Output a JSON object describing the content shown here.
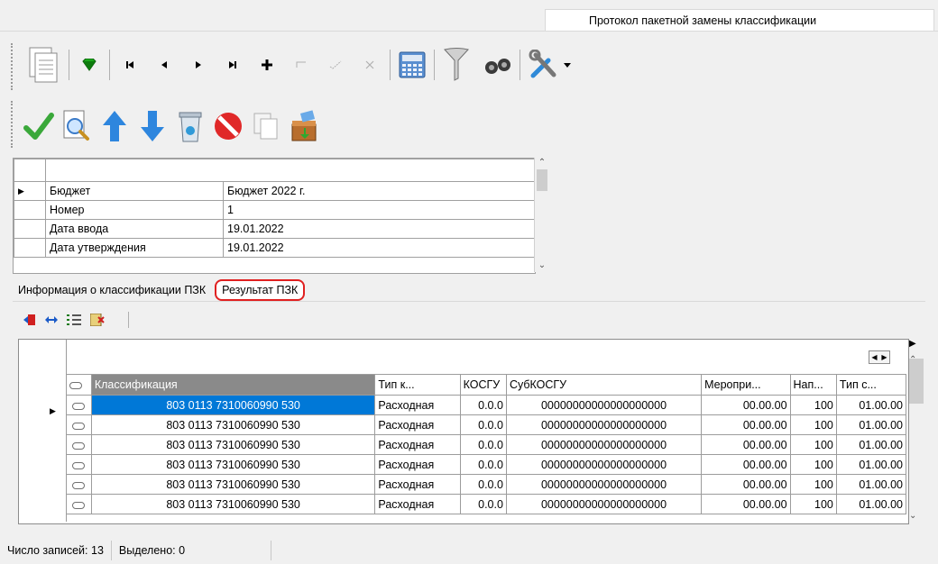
{
  "window": {
    "tab_title": "Протокол пакетной замены классификации"
  },
  "toolbar1": {
    "icons": [
      "document-icon",
      "gem-icon",
      "first-record-icon",
      "prev-record-icon",
      "next-record-icon",
      "last-record-icon",
      "add-icon",
      "edit-icon",
      "post-icon",
      "cancel-icon",
      "calculator-icon",
      "filter-icon",
      "binoculars-icon",
      "tools-icon",
      "dropdown-arrow-icon"
    ]
  },
  "toolbar2": {
    "icons": [
      "checkmark-icon",
      "preview-icon",
      "arrow-up-icon",
      "arrow-down-icon",
      "trash-icon",
      "stop-icon",
      "copy-icon",
      "export-icon"
    ]
  },
  "header_grid": {
    "rows": [
      {
        "label": "Бюджет",
        "value": "Бюджет 2022 г."
      },
      {
        "label": "Номер",
        "value": "1"
      },
      {
        "label": "Дата ввода",
        "value": "19.01.2022"
      },
      {
        "label": "Дата утверждения",
        "value": "19.01.2022"
      }
    ]
  },
  "tabs": [
    {
      "label": "Информация о классификации ПЗК"
    },
    {
      "label": "Результат ПЗК"
    }
  ],
  "result_grid": {
    "columns": [
      "Классификация",
      "Тип к...",
      "КОСГУ",
      "СубКОСГУ",
      "Меропри...",
      "Нап...",
      "Тип с..."
    ],
    "rows": [
      [
        "803 0113 7310060990 530",
        "Расходная",
        "0.0.0",
        "00000000000000000000",
        "00.00.00",
        "100",
        "01.00.00"
      ],
      [
        "803 0113 7310060990 530",
        "Расходная",
        "0.0.0",
        "00000000000000000000",
        "00.00.00",
        "100",
        "01.00.00"
      ],
      [
        "803 0113 7310060990 530",
        "Расходная",
        "0.0.0",
        "00000000000000000000",
        "00.00.00",
        "100",
        "01.00.00"
      ],
      [
        "803 0113 7310060990 530",
        "Расходная",
        "0.0.0",
        "00000000000000000000",
        "00.00.00",
        "100",
        "01.00.00"
      ],
      [
        "803 0113 7310060990 530",
        "Расходная",
        "0.0.0",
        "00000000000000000000",
        "00.00.00",
        "100",
        "01.00.00"
      ],
      [
        "803 0113 7310060990 530",
        "Расходная",
        "0.0.0",
        "00000000000000000000",
        "00.00.00",
        "100",
        "01.00.00"
      ]
    ]
  },
  "status": {
    "records_label": "Число записей:",
    "records_value": "13",
    "selected_label": "Выделено:",
    "selected_value": "0"
  },
  "colors": {
    "selection": "#0078d7",
    "tab_highlight": "#e02020"
  }
}
